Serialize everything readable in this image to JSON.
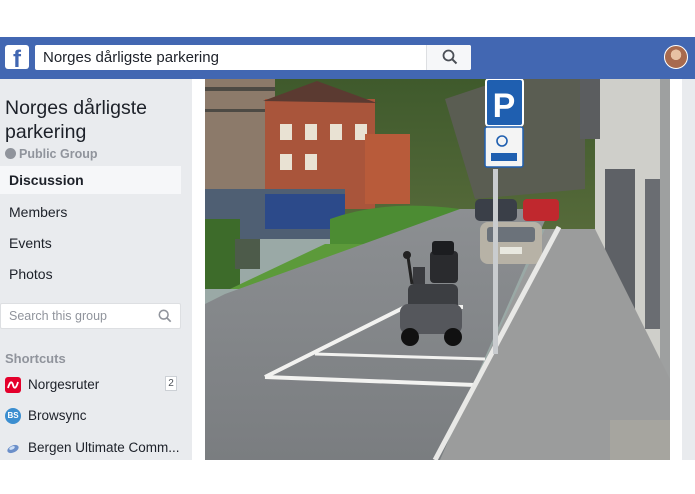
{
  "header": {
    "search_value": "Norges dårligste parkering",
    "logo_letter": "f",
    "brand_color": "#4267b2"
  },
  "group": {
    "name": "Norges dårligste parkering",
    "privacy": "Public Group"
  },
  "nav": {
    "items": [
      {
        "label": "Discussion",
        "active": true
      },
      {
        "label": "Members"
      },
      {
        "label": "Events"
      },
      {
        "label": "Photos"
      }
    ]
  },
  "group_search": {
    "placeholder": "Search this group"
  },
  "shortcuts": {
    "heading": "Shortcuts",
    "items": [
      {
        "label": "Norgesruter",
        "count": "2",
        "icon": "norgesruter-icon",
        "icon_text": "N",
        "color": "#e4002b"
      },
      {
        "label": "Browsync",
        "icon": "browsync-icon",
        "icon_text": "BS",
        "color": "#3b8ed0"
      },
      {
        "label": "Bergen Ultimate Comm...",
        "icon": "bergen-ultimate-icon",
        "icon_text": "",
        "color": "#4a6fa5"
      }
    ]
  },
  "post_photo": {
    "sign_letter": "P",
    "sign_color": "#1f5fb0"
  }
}
